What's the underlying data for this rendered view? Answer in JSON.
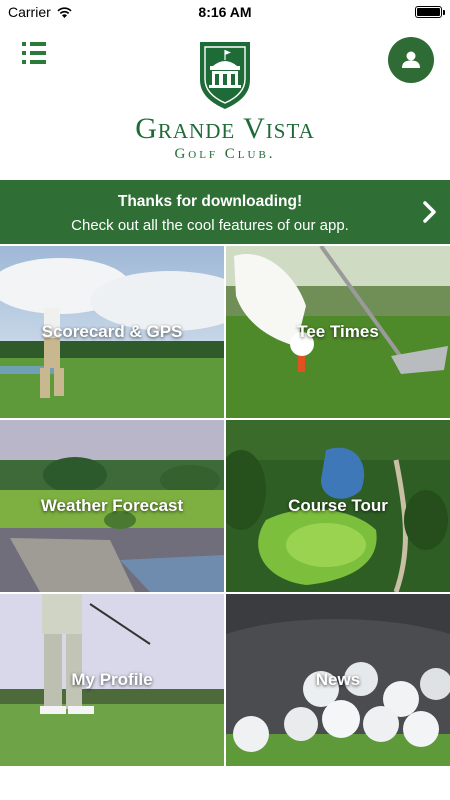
{
  "status_bar": {
    "carrier": "Carrier",
    "time": "8:16 AM"
  },
  "header": {
    "brand_name": "Grande Vista",
    "brand_sub": "Golf Club.",
    "icons": {
      "menu": "list-menu-icon",
      "profile": "user-icon",
      "crest": "clubhouse-crest-logo"
    }
  },
  "banner": {
    "title": "Thanks for downloading!",
    "text": "Check out all the cool features of our app."
  },
  "tiles": [
    {
      "label": "Scorecard & GPS"
    },
    {
      "label": "Tee Times"
    },
    {
      "label": "Weather Forecast"
    },
    {
      "label": "Course Tour"
    },
    {
      "label": "My Profile"
    },
    {
      "label": "News"
    }
  ],
  "colors": {
    "brand_green": "#2f6e34",
    "logo_green": "#1f6b38"
  }
}
